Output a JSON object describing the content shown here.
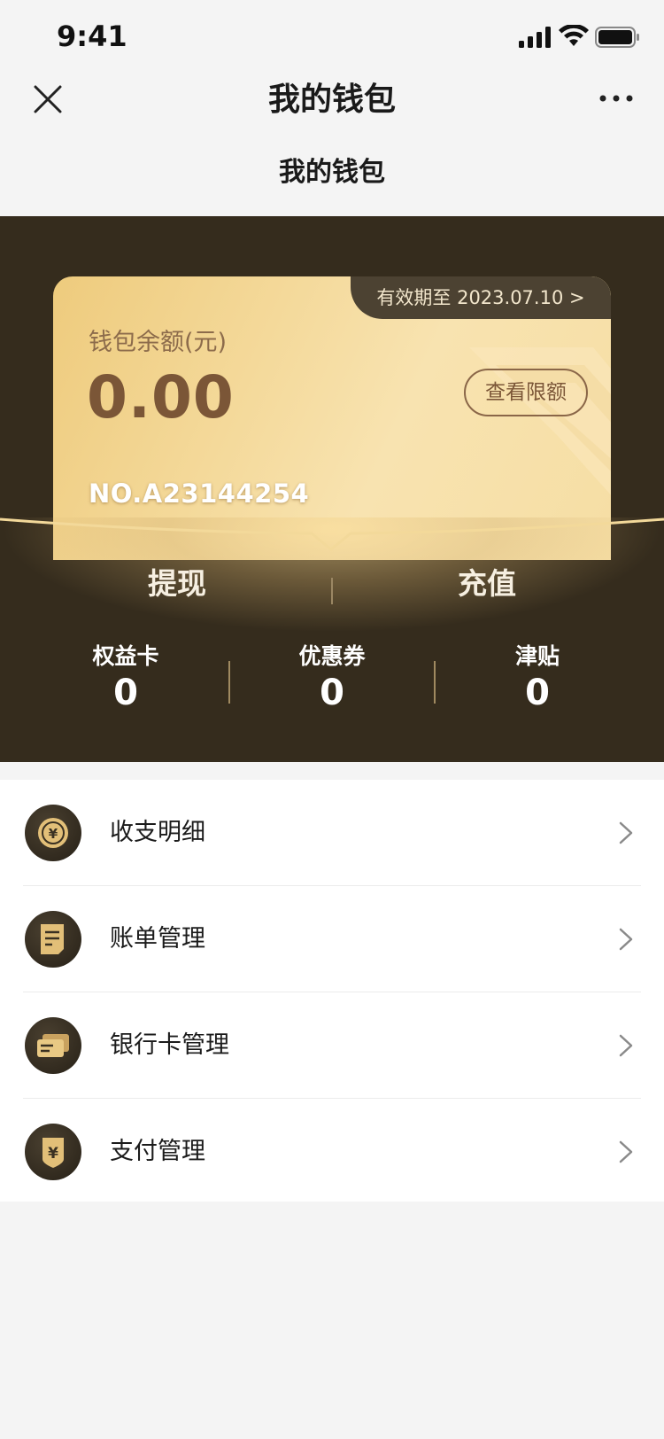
{
  "status_bar": {
    "time": "9:41",
    "icons": [
      "signal-icon",
      "wifi-icon",
      "battery-icon"
    ]
  },
  "nav": {
    "title": "我的钱包",
    "close_icon": "close-icon",
    "more_icon": "more-icon"
  },
  "sub_title": "我的钱包",
  "card": {
    "expiry": "有效期至 2023.07.10 >",
    "balance_label": "钱包余额(元)",
    "balance_value": "0.00",
    "limit_button": "查看限额",
    "card_number": "NO.A23144254"
  },
  "actions": {
    "withdraw": "提现",
    "recharge": "充值"
  },
  "stats": [
    {
      "label": "权益卡",
      "value": "0"
    },
    {
      "label": "优惠券",
      "value": "0"
    },
    {
      "label": "津贴",
      "value": "0"
    }
  ],
  "menu": [
    {
      "label": "收支明细",
      "icon": "coin-icon"
    },
    {
      "label": "账单管理",
      "icon": "bill-icon"
    },
    {
      "label": "银行卡管理",
      "icon": "bank-card-icon"
    },
    {
      "label": "支付管理",
      "icon": "payment-shield-icon"
    }
  ],
  "colors": {
    "hero_bg": "#352c1d",
    "card_gold": "#f4d99a",
    "balance_brown": "#7b5637",
    "page_bg": "#f4f4f4"
  }
}
